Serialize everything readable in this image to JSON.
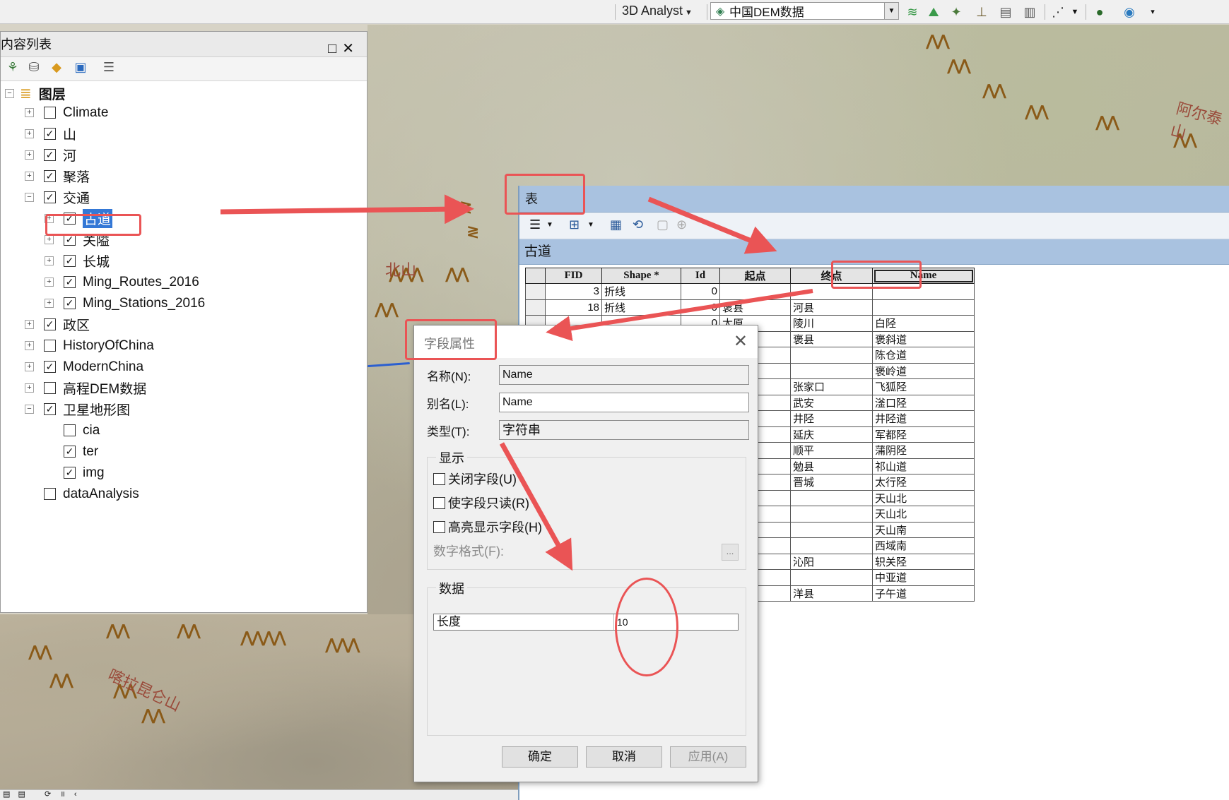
{
  "toolbar": {
    "analyst_label": "3D Analyst",
    "layer_dropdown_value": "中国DEM数据"
  },
  "toc": {
    "title": "内容列表",
    "root_label": "图层",
    "items": [
      {
        "label": "Climate",
        "checked": false,
        "expander": "+"
      },
      {
        "label": "山",
        "checked": true,
        "expander": "+"
      },
      {
        "label": "河",
        "checked": true,
        "expander": "+"
      },
      {
        "label": "聚落",
        "checked": true,
        "expander": "+"
      },
      {
        "label": "交通",
        "checked": true,
        "expander": "−"
      },
      {
        "label": "古道",
        "checked": true,
        "expander": "+",
        "selected": true
      },
      {
        "label": "关隘",
        "checked": true,
        "expander": "+"
      },
      {
        "label": "长城",
        "checked": true,
        "expander": "+"
      },
      {
        "label": "Ming_Routes_2016",
        "checked": true,
        "expander": "+"
      },
      {
        "label": "Ming_Stations_2016",
        "checked": true,
        "expander": "+"
      },
      {
        "label": "政区",
        "checked": true,
        "expander": "+"
      },
      {
        "label": "HistoryOfChina",
        "checked": false,
        "expander": "+"
      },
      {
        "label": "ModernChina",
        "checked": true,
        "expander": "+"
      },
      {
        "label": "高程DEM数据",
        "checked": false,
        "expander": "+"
      },
      {
        "label": "卫星地形图",
        "checked": true,
        "expander": "−"
      },
      {
        "label": "cia",
        "checked": false,
        "expander": ""
      },
      {
        "label": "ter",
        "checked": true,
        "expander": ""
      },
      {
        "label": "img",
        "checked": true,
        "expander": ""
      },
      {
        "label": "dataAnalysis",
        "checked": false,
        "expander": ""
      }
    ]
  },
  "map": {
    "labels": [
      "北山",
      "阿尔泰山",
      "喀拉昆仑山"
    ]
  },
  "table": {
    "window_title": "表",
    "tab_title": "古道",
    "columns": [
      "FID",
      "Shape *",
      "Id",
      "起点",
      "终点",
      "Name"
    ],
    "rows": [
      [
        "3",
        "折线",
        "0",
        "",
        "",
        ""
      ],
      [
        "18",
        "折线",
        "0",
        "褒县",
        "河县",
        ""
      ],
      [
        "",
        "",
        "0",
        "太原",
        "陵川",
        "白陉"
      ],
      [
        "",
        "",
        "",
        "",
        "褒县",
        "褒斜道"
      ],
      [
        "",
        "",
        "",
        "",
        "",
        "陈仓道"
      ],
      [
        "",
        "",
        "",
        "",
        "",
        "褒岭道"
      ],
      [
        "",
        "",
        "",
        "",
        "张家口",
        "飞狐陉"
      ],
      [
        "",
        "",
        "",
        "",
        "武安",
        "滏口陉"
      ],
      [
        "",
        "",
        "",
        "",
        "井陉",
        "井陉道"
      ],
      [
        "",
        "",
        "",
        "",
        "延庆",
        "军都陉"
      ],
      [
        "",
        "",
        "",
        "",
        "顺平",
        "蒲阴陉"
      ],
      [
        "",
        "",
        "",
        "",
        "勉县",
        "祁山道"
      ],
      [
        "",
        "",
        "",
        "",
        "晋城",
        "太行陉"
      ],
      [
        "",
        "",
        "",
        "",
        "",
        "天山北"
      ],
      [
        "",
        "",
        "",
        "",
        "",
        "天山北"
      ],
      [
        "",
        "",
        "",
        "",
        "",
        "天山南"
      ],
      [
        "",
        "",
        "",
        "",
        "",
        "西域南"
      ],
      [
        "",
        "",
        "",
        "",
        "沁阳",
        "轵关陉"
      ],
      [
        "",
        "",
        "",
        "",
        "",
        "中亚道"
      ],
      [
        "",
        "",
        "",
        "",
        "洋县",
        "子午道"
      ]
    ]
  },
  "dialog": {
    "title": "字段属性",
    "name_label": "名称(N):",
    "name_value": "Name",
    "alias_label": "别名(L):",
    "alias_value": "Name",
    "type_label": "类型(T):",
    "type_value": "字符串",
    "display_group": "显示",
    "cb_hide": "关闭字段(U)",
    "cb_readonly": "使字段只读(R)",
    "cb_highlight": "高亮显示字段(H)",
    "number_format": "数字格式(F):",
    "ellipsis": "...",
    "data_group": "数据",
    "length_label": "长度",
    "length_value": "10",
    "ok": "确定",
    "cancel": "取消",
    "apply": "应用(A)"
  },
  "colors": {
    "annotation": "#ea5455",
    "title_bar": "#a9c2e0",
    "selection": "#3478d6"
  }
}
